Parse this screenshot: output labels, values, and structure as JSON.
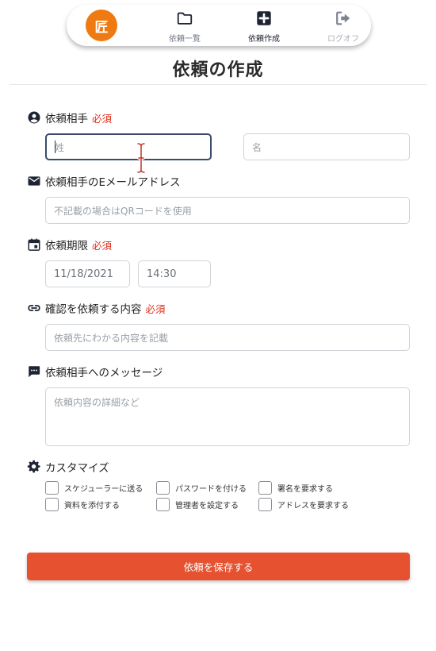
{
  "nav": {
    "logo_text": "匠",
    "items": [
      {
        "label": "依頼一覧",
        "icon": "folder-icon"
      },
      {
        "label": "依頼作成",
        "icon": "plus-square-icon"
      },
      {
        "label": "ログオフ",
        "icon": "logout-icon"
      }
    ]
  },
  "page_title": "依頼の作成",
  "form": {
    "recipient": {
      "label": "依頼相手",
      "required": "必須",
      "last_name_placeholder": "姓",
      "first_name_placeholder": "名"
    },
    "email": {
      "label": "依頼相手のEメールアドレス",
      "placeholder": "不記載の場合はQRコードを使用"
    },
    "deadline": {
      "label": "依頼期限",
      "required": "必須",
      "date": "11/18/2021",
      "time": "14:30"
    },
    "content": {
      "label": "確認を依頼する内容",
      "required": "必須",
      "placeholder": "依頼先にわかる内容を記載"
    },
    "message": {
      "label": "依頼相手へのメッセージ",
      "placeholder": "依頼内容の詳細など"
    },
    "customize": {
      "label": "カスタマイズ",
      "options": [
        "スケジューラーに送る",
        "パスワードを付ける",
        "署名を要求する",
        "資料を添付する",
        "管理者を設定する",
        "アドレスを要求する"
      ]
    },
    "save_label": "依頼を保存する"
  },
  "colors": {
    "accent": "#e6512f",
    "logo": "#ef7a12",
    "required": "#e0301e",
    "icon": "#1e2433"
  }
}
